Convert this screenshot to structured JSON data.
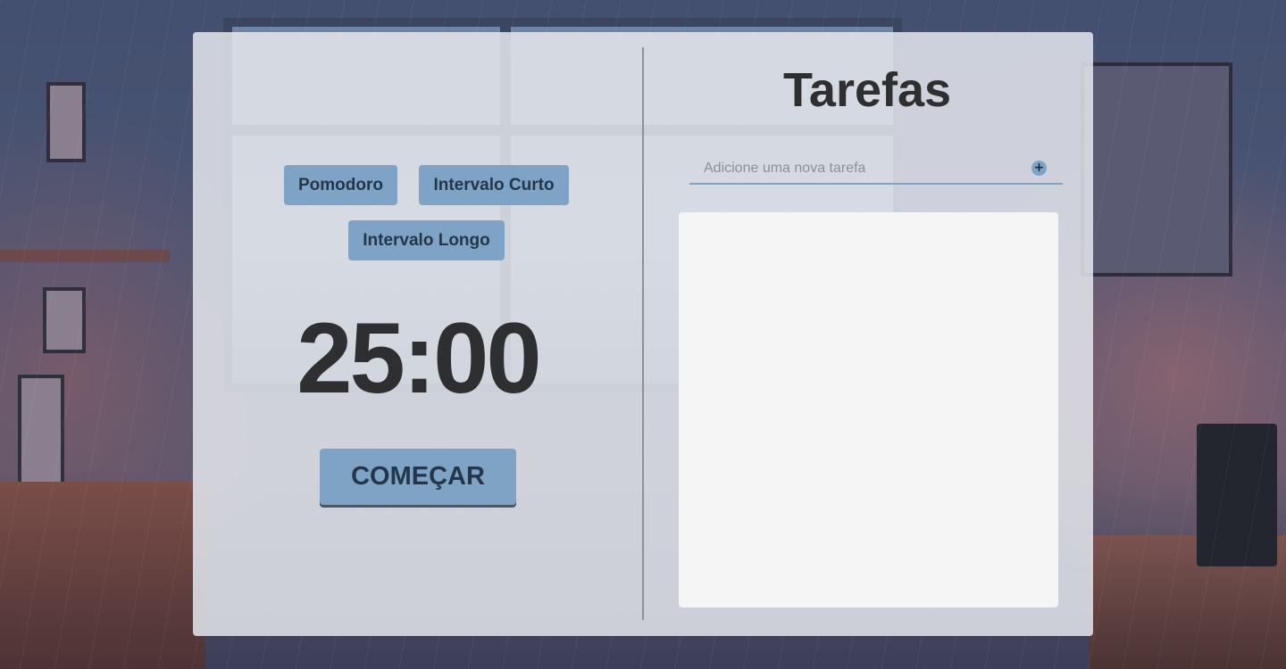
{
  "timer_panel": {
    "modes": [
      {
        "label": "Pomodoro"
      },
      {
        "label": "Intervalo Curto"
      },
      {
        "label": "Intervalo Longo"
      }
    ],
    "time_display": "25:00",
    "start_label": "COMEÇAR"
  },
  "tasks_panel": {
    "title": "Tarefas",
    "input": {
      "value": "",
      "placeholder": "Adicione uma nova tarefa"
    },
    "add_icon": "plus-icon",
    "add_symbol": "+",
    "items": []
  },
  "colors": {
    "accent": "#7fa3c4",
    "button_text": "#24364a",
    "title_text": "#2f2f31",
    "card_background": "#e4e6ec",
    "list_background": "#f6f5f6"
  }
}
